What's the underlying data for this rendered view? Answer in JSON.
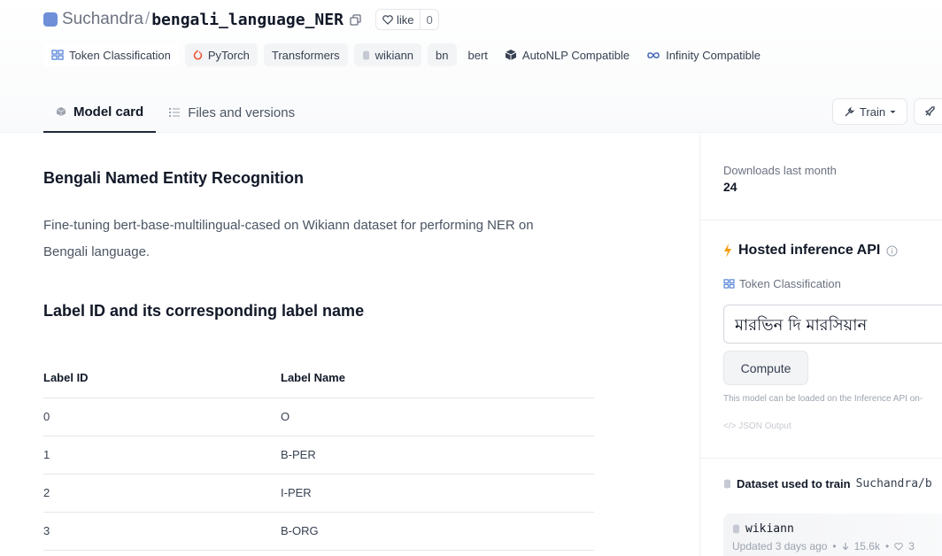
{
  "header": {
    "owner": "Suchandra",
    "separator": "/",
    "repo_name": "bengali_language_NER",
    "like_label": "like",
    "like_count": "0"
  },
  "tags": [
    {
      "label": "Token Classification",
      "icon": "token-classification-icon"
    },
    {
      "label": "PyTorch",
      "icon": "pytorch-icon"
    },
    {
      "label": "Transformers",
      "icon": ""
    },
    {
      "label": "wikiann",
      "icon": "dataset-icon"
    },
    {
      "label": "bn",
      "icon": ""
    },
    {
      "label": "bert",
      "icon": ""
    },
    {
      "label": "AutoNLP Compatible",
      "icon": "cube-icon"
    },
    {
      "label": "Infinity Compatible",
      "icon": "infinity-icon"
    }
  ],
  "tabs": [
    {
      "label": "Model card",
      "active": true
    },
    {
      "label": "Files and versions",
      "active": false
    }
  ],
  "actions": {
    "train_label": "Train"
  },
  "content": {
    "heading1": "Bengali Named Entity Recognition",
    "paragraph": "Fine-tuning bert-base-multilingual-cased on Wikiann dataset for performing NER on Bengali language.",
    "heading2": "Label ID and its corresponding label name",
    "table": {
      "headers": [
        "Label ID",
        "Label Name"
      ],
      "rows": [
        [
          "0",
          "O"
        ],
        [
          "1",
          "B-PER"
        ],
        [
          "2",
          "I-PER"
        ],
        [
          "3",
          "B-ORG"
        ]
      ]
    }
  },
  "sidebar": {
    "downloads_label": "Downloads last month",
    "downloads_value": "24",
    "inference_title": "Hosted inference API",
    "inference_task": "Token Classification",
    "input_value": "মারভিন দি মারসিয়ান",
    "compute_label": "Compute",
    "note": "This model can be loaded on the Inference API on-",
    "json_output": "JSON Output",
    "dataset_title": "Dataset used to train",
    "dataset_ref": "Suchandra/b",
    "dataset_name": "wikiann",
    "dataset_updated": "Updated 3 days ago",
    "dataset_downloads": "15.6k",
    "dataset_likes": "3"
  },
  "colors": {
    "accent_orange": "#f59e0b",
    "text_dark": "#111827",
    "muted": "#6b7280"
  }
}
